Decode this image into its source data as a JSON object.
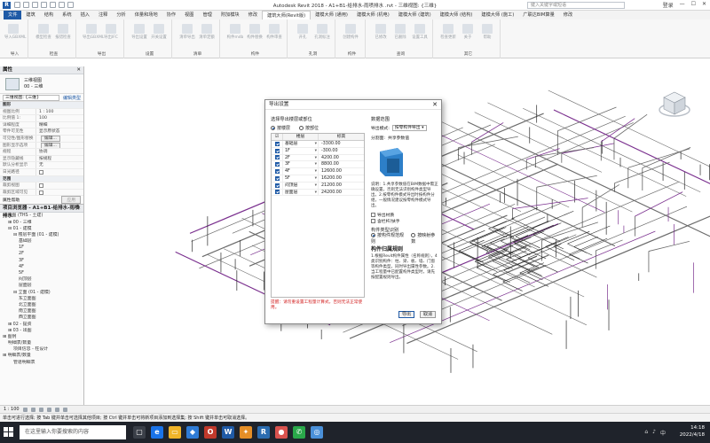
{
  "titlebar": {
    "title": "Autodesk Revit 2018 -    A1+B1-给排水-雨喷排水 .rvt - 三维视图: {三维}",
    "search_placeholder": "键入关键字或短语",
    "sign_in": "登录"
  },
  "menu": {
    "tabs": [
      "文件",
      "建筑",
      "结构",
      "系统",
      "插入",
      "注释",
      "分析",
      "体量和场地",
      "协作",
      "视图",
      "管理",
      "附加模块",
      "修改",
      "建筑大师(Revit版)",
      "建模大师 (通用)",
      "建模大师 (机电)",
      "建模大师 (建筑)",
      "建模大师 (结构)",
      "建模大师 (施工)",
      "广联达BIM算量",
      "修改"
    ],
    "active_index": 13
  },
  "ribbon": {
    "groups": [
      {
        "label": "导入",
        "buttons": [
          "导入GBXML"
        ]
      },
      {
        "label": "检查",
        "buttons": [
          "模型检查",
          "报错检查"
        ]
      },
      {
        "label": "导出",
        "buttons": [
          "导出GBXML",
          "导出IFC"
        ]
      },
      {
        "label": "设置",
        "buttons": [
          "导出设置",
          "开关设置"
        ]
      },
      {
        "label": "清单",
        "buttons": [
          "清单导出",
          "清单定额"
        ]
      },
      {
        "label": "构件",
        "buttons": [
          "构件mdb",
          "构件替换",
          "构件审查"
        ]
      },
      {
        "label": "孔洞",
        "buttons": [
          "开孔",
          "孔洞标注"
        ]
      },
      {
        "label": "构件",
        "buttons": [
          "创建构件"
        ]
      },
      {
        "label": "查询",
        "buttons": [
          "已修改",
          "已删除",
          "设置工具"
        ]
      },
      {
        "label": "其它",
        "buttons": [
          "检查更新",
          "关于",
          "帮助"
        ]
      }
    ]
  },
  "properties": {
    "header": "属性",
    "type_name": "三维视图",
    "type_sub": "00 - 三维",
    "selector": "三维视图: {三维}",
    "edit_type": "编辑类型",
    "rows": [
      {
        "k": "图形",
        "v": "",
        "cat": true
      },
      {
        "k": "视图比例",
        "v": "1 : 100"
      },
      {
        "k": "比例值 1:",
        "v": "100"
      },
      {
        "k": "详细程度",
        "v": "精细"
      },
      {
        "k": "零件可见性",
        "v": "显示原状态"
      },
      {
        "k": "可见性/图形替换",
        "v": "编辑...",
        "btn": true
      },
      {
        "k": "图形显示选项",
        "v": "编辑...",
        "btn": true
      },
      {
        "k": "规程",
        "v": "协调"
      },
      {
        "k": "显示隐藏线",
        "v": "按规程"
      },
      {
        "k": "默认分析显示",
        "v": "无"
      },
      {
        "k": "日光路径",
        "v": "",
        "chk": true
      },
      {
        "k": "范围",
        "v": "",
        "cat": true
      },
      {
        "k": "裁剪视图",
        "v": "",
        "chk": true
      },
      {
        "k": "裁剪区域可见",
        "v": "",
        "chk": true
      }
    ],
    "help": "属性帮助",
    "apply": "应用"
  },
  "browser": {
    "header": "项目浏览器 - A1+B1-给排水-雨喷排水",
    "nodes": [
      {
        "t": "⊟ 视图 (THS - 土建)",
        "d": 0
      },
      {
        "t": "⊞ 00 - 三维",
        "d": 1
      },
      {
        "t": "⊟ 01 - 建模",
        "d": 1
      },
      {
        "t": "⊟ 楼层平面 (01 - 建模)",
        "d": 2
      },
      {
        "t": "基础层",
        "d": 3
      },
      {
        "t": "1F",
        "d": 3
      },
      {
        "t": "2F",
        "d": 3
      },
      {
        "t": "3F",
        "d": 3
      },
      {
        "t": "4F",
        "d": 3
      },
      {
        "t": "5F",
        "d": 3
      },
      {
        "t": "闷顶层",
        "d": 3
      },
      {
        "t": "屋面层",
        "d": 3
      },
      {
        "t": "⊟ 立面 (01 - 建模)",
        "d": 2
      },
      {
        "t": "东立面图",
        "d": 3
      },
      {
        "t": "北立面图",
        "d": 3
      },
      {
        "t": "南立面图",
        "d": 3
      },
      {
        "t": "西立面图",
        "d": 3
      },
      {
        "t": "⊞ 02 - 提资",
        "d": 1
      },
      {
        "t": "⊞ 03 - 出图",
        "d": 1
      },
      {
        "t": "⊞ 图例",
        "d": 0
      },
      {
        "t": "明细表/数量",
        "d": 1
      },
      {
        "t": "项目信息 - 柱设计",
        "d": 2
      },
      {
        "t": "⊞ 明细表/数量",
        "d": 0
      },
      {
        "t": "管道明细表",
        "d": 2
      }
    ]
  },
  "dialog": {
    "title": "导出设置",
    "section_left": "选择导出楼层或部位",
    "radio_floor": "按楼层",
    "radio_part": "按部位",
    "col_name": "楼层",
    "col_elev": "标高",
    "floors": [
      {
        "name": "基础层",
        "elev": "-3300.00"
      },
      {
        "name": "1F",
        "elev": "-300.00"
      },
      {
        "name": "2F",
        "elev": "4200.00"
      },
      {
        "name": "3F",
        "elev": "8800.00"
      },
      {
        "name": "4F",
        "elev": "12600.00"
      },
      {
        "name": "5F",
        "elev": "16200.00"
      },
      {
        "name": "闷顶层",
        "elev": "21200.00"
      },
      {
        "name": "屋面层",
        "elev": "24200.00"
      }
    ],
    "note": "提醒：请勿重设置工程量计算式，否则无法正常使用。",
    "section_right": "数据范围",
    "export_mode_label": "导出模式:",
    "export_mode_value": "按零构件导出",
    "sub_label": "分割面:",
    "sub_value": "共享参数值",
    "desc": "说明：1.共享参数值在BIM数据中需正确设置，否则无法识别构件类型导出。2.按零构件模式导出时按构件分组，一般情况建议按零构件模式导出。",
    "chk1": "导出材质",
    "chk2": "含栏杆/扶手",
    "section_rule": "构件类型识别",
    "radio_rule1": "按构件规范规则",
    "radio_rule2": "按映射参数",
    "rule_head": "构件归属规则",
    "rule_text": "1.根据Revit构件属性（名称规则），4类识别构件：柱、梁、板、墙、门窗等构件类型，同时导出属性参数。2.当工程量中已配置构件类型时，请先按配置规则导出。",
    "ok": "导出",
    "cancel": "取消"
  },
  "viewbar": {
    "scale": "1 : 100"
  },
  "status": {
    "text": "单击可进行选择; 按 Tab 键并单击可选择其他项目; 按 Ctrl 键并单击可将新项目添加到选择集; 按 Shift 键并单击可取消选择。"
  },
  "taskbar": {
    "search": "在这里输入你要搜索的内容",
    "time": "14:18",
    "date": "2022/4/18",
    "lang": "中"
  },
  "colors": {
    "accent": "#1f5aa6",
    "pipe_purple": "#7a2f8e",
    "note_red": "#d21f1f"
  }
}
